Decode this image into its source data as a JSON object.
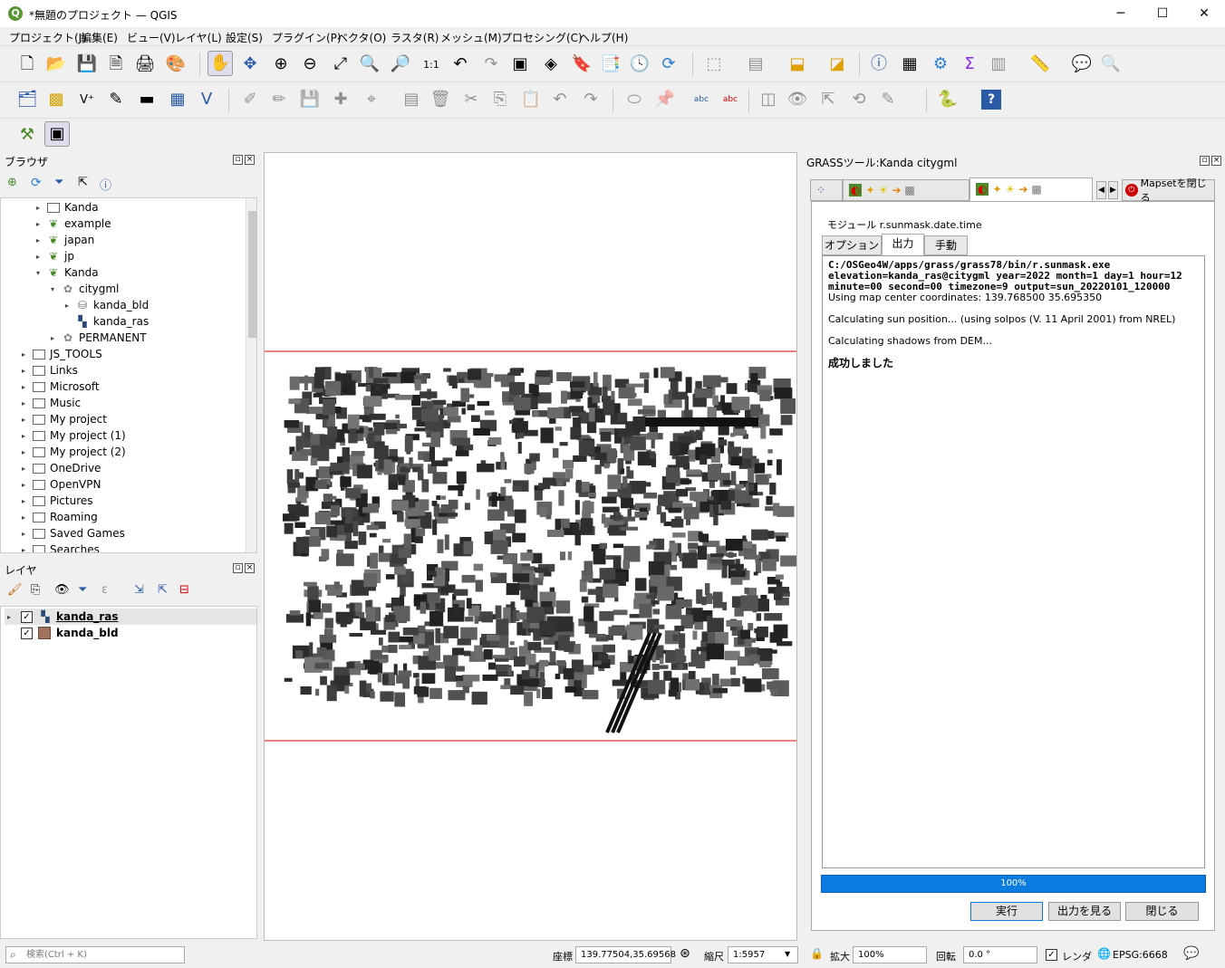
{
  "window": {
    "title": "*無題のプロジェクト — QGIS",
    "logo": "Q",
    "minimize": "─",
    "maximize": "☐",
    "close": "✕"
  },
  "menu": [
    "プロジェクト(J)",
    "編集(E)",
    "ビュー(V)",
    "レイヤ(L)",
    "設定(S)",
    "プラグイン(P)",
    "ベクタ(O)",
    "ラスタ(R)",
    "メッシュ(M)",
    "プロセシング(C)",
    "ヘルプ(H)"
  ],
  "browser": {
    "title": "ブラウザ",
    "items": [
      {
        "label": "Kanda",
        "icon": "folder"
      },
      {
        "label": "example",
        "icon": "grass-location-icon"
      },
      {
        "label": "japan",
        "icon": "grass-location-icon"
      },
      {
        "label": "jp",
        "icon": "grass-location-icon"
      },
      {
        "label": "Kanda",
        "icon": "grass-location-icon"
      },
      {
        "label": "citygml",
        "icon": "grass-mapset-icon"
      },
      {
        "label": "kanda_bld",
        "icon": "vector-db-icon"
      },
      {
        "label": "kanda_ras",
        "icon": "raster-icon"
      },
      {
        "label": "PERMANENT",
        "icon": "grass-mapset-icon"
      },
      {
        "label": "JS_TOOLS",
        "icon": "folder"
      },
      {
        "label": "Links",
        "icon": "folder"
      },
      {
        "label": "Microsoft",
        "icon": "folder"
      },
      {
        "label": "Music",
        "icon": "folder"
      },
      {
        "label": "My project",
        "icon": "folder"
      },
      {
        "label": "My project (1)",
        "icon": "folder"
      },
      {
        "label": "My project (2)",
        "icon": "folder"
      },
      {
        "label": "OneDrive",
        "icon": "folder"
      },
      {
        "label": "OpenVPN",
        "icon": "folder"
      },
      {
        "label": "Pictures",
        "icon": "folder"
      },
      {
        "label": "Roaming",
        "icon": "folder"
      },
      {
        "label": "Saved Games",
        "icon": "folder"
      },
      {
        "label": "Searches",
        "icon": "folder"
      }
    ]
  },
  "layers": {
    "title": "レイヤ",
    "items": [
      {
        "label": "kanda_ras",
        "checked": "✓",
        "swatch": "raster"
      },
      {
        "label": "kanda_bld",
        "checked": "✓",
        "swatch": "#a0725e"
      }
    ]
  },
  "grass": {
    "title": "GRASSツール:Kanda citygml",
    "close_mapset": "Mapsetを閉じる",
    "module_label": "モジュール r.sunmask.date.time",
    "subtabs": [
      "オプション",
      "出力",
      "手動"
    ],
    "output_cmd": [
      "C:/OSGeo4W/apps/grass/grass78/bin/r.sunmask.exe",
      "elevation=kanda_ras@citygml year=2022 month=1 day=1 hour=12",
      "minute=00 second=00 timezone=9 output=sun_20220101_120000"
    ],
    "output_lines": [
      "Using map center coordinates: 139.768500 35.695350",
      "Calculating sun position... (using solpos (V. 11 April 2001) from NREL)",
      "Calculating shadows from DEM..."
    ],
    "success": "成功しました",
    "progress": 1.0,
    "progress_label": "100%",
    "buttons": {
      "run": "実行",
      "view_output": "出力を見る",
      "close": "閉じる"
    }
  },
  "status": {
    "search_placeholder": "検索(Ctrl + K)",
    "coord_label": "座標",
    "coord_value": "139.77504,35.69568",
    "scale_label": "縮尺",
    "scale_value": "1:5957",
    "zoom_label": "拡大",
    "zoom_value": "100%",
    "rotation_label": "回転",
    "rotation_value": "0.0 °",
    "render_label": "レンダ",
    "render_checked": "✓",
    "crs": "EPSG:6668"
  }
}
